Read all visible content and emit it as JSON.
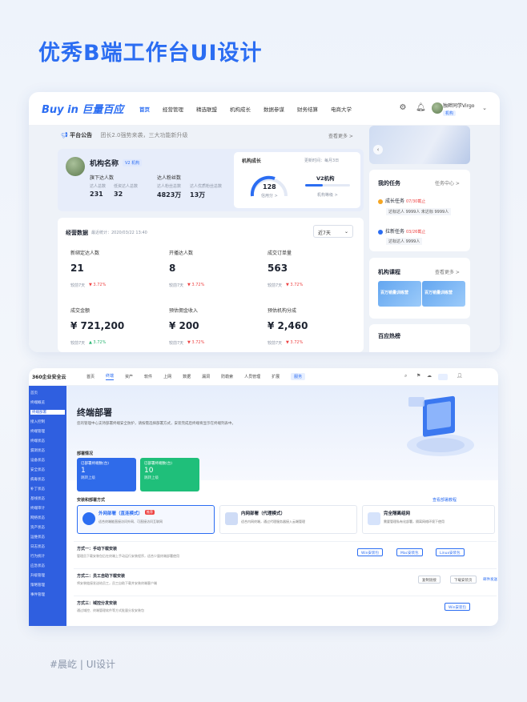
{
  "hero_title": "优秀B端工作台UI设计",
  "footer": "#晨屹 | UI设计",
  "card1": {
    "logo": "Buy in 巨量百应",
    "nav": [
      "首页",
      "经营管理",
      "精选联盟",
      "机构成长",
      "数据参谋",
      "财务结算",
      "电商大学"
    ],
    "user": {
      "name": "独畔同学Virgo",
      "tag": "机构"
    },
    "announce": {
      "title": "平台公告",
      "text": "团长2.0强势来袭，三大功能新升级",
      "more": "查看更多 >"
    },
    "org": {
      "name": "机构名称",
      "badge": "V2 机构",
      "talent_title": "旗下达人数",
      "talent_labels": [
        "达人总数",
        "低资达人总数"
      ],
      "talent_values": [
        "231",
        "32"
      ],
      "fans_title": "达人粉丝数",
      "fans_labels": [
        "达人粉丝总数",
        "达人优质粉丝总数"
      ],
      "fans_values": [
        "4823万",
        "13万"
      ],
      "growth_title": "机构成长",
      "update_time": "更新时间：每月3日",
      "score": "128",
      "score_label": "信用分 >",
      "level": "V2机构",
      "level_link": "机构等级 >"
    },
    "data": {
      "title": "经营数据",
      "updated": "最近统计：2020/03/22 13:40",
      "range": "近7天",
      "metrics": [
        {
          "label": "新绑定达人数",
          "value": "21",
          "cmp": "较前7天",
          "delta": "▼ 3.72%",
          "dir": "down"
        },
        {
          "label": "开播达人数",
          "value": "8",
          "cmp": "较前7天",
          "delta": "▼ 3.72%",
          "dir": "down"
        },
        {
          "label": "成交订单量",
          "value": "563",
          "cmp": "较前7天",
          "delta": "▼ 3.72%",
          "dir": "down"
        },
        {
          "label": "成交金额",
          "value": "¥ 721,200",
          "cmp": "较前7天",
          "delta": "▲ 3.72%",
          "dir": "up"
        },
        {
          "label": "预估佣金收入",
          "value": "¥ 200",
          "cmp": "较前7天",
          "delta": "▼ 3.72%",
          "dir": "down"
        },
        {
          "label": "预估机构分成",
          "value": "¥ 2,460",
          "cmp": "较前7天",
          "delta": "▼ 3.72%",
          "dir": "down"
        }
      ]
    },
    "tasks": {
      "title": "我的任务",
      "link": "任务中心 >",
      "items": [
        {
          "name": "成长任务",
          "date": "07/30截止",
          "line": "达标达人 9999人  未达标 9999人"
        },
        {
          "name": "拉新任务",
          "date": "03/26截止",
          "line": "达标达人 9999人"
        }
      ]
    },
    "course": {
      "title": "机构课程",
      "more": "查看更多 >",
      "items": [
        "百万销量训练营",
        "百万销量训练营"
      ]
    },
    "hot": {
      "title": "百应热榜"
    }
  },
  "card2": {
    "logo": "360企业安全云",
    "nav": [
      "首页",
      "终端",
      "资产",
      "软件",
      "上网",
      "数据",
      "漏洞",
      "防勒索",
      "人员管理",
      "扩展"
    ],
    "nav_extra": "服务",
    "side": [
      "首页",
      "终端概览",
      "终端部署",
      "接入控制",
      "终端管理",
      "终端状态",
      "漏洞状态",
      "设备状态",
      "安全状态",
      "病毒状态",
      "补丁状态",
      "基线状态",
      "终端审计",
      "网络状态",
      "资产状态",
      "运维状态",
      "日志状态",
      "行为统计",
      "应急状态",
      "升级管理",
      "策略管理",
      "事件管理"
    ],
    "hero": {
      "title": "终端部署",
      "desc": "您的管理中心支持部署终端安全防护，请按需选择部署方式，安装完成后终端将显示在终端列表中。"
    },
    "stats_title": "部署情况",
    "stats": [
      {
        "label": "已部署终端数(台)",
        "value": "1",
        "sub": "跳转上级"
      },
      {
        "label": "已部署终端数(台)",
        "value": "10",
        "sub": "跳转上级"
      }
    ],
    "section_title": "安装和部署方式",
    "section_link": "查看部署教程",
    "options": [
      {
        "title": "外网部署（直连模式）",
        "tag": "推荐",
        "desc": "适合终端能直接访问外网、可直接访问互联网"
      },
      {
        "title": "内网部署（代理模式）",
        "desc": "适合内网终端，通过代理服务器接入云端管理"
      },
      {
        "title": "完全隔离组网",
        "desc": "需要管理私有化部署，隔离网络环境下使用"
      }
    ],
    "methods": [
      {
        "title": "方式一：手动下载安装",
        "desc": "管理员下载安装包后在终端上手动运行安装程序，适合少量终端部署使用",
        "buttons": [
          "Win安装包",
          "Mac安装包",
          "Linux安装包"
        ]
      },
      {
        "title": "方式二：员工自助下载安装",
        "desc": "将安装链接发送给员工，员工自助下载并安装终端客户端",
        "buttons": [
          "复制链接",
          "下载安装页",
          "邮件发送"
        ]
      },
      {
        "title": "方式三：域控分发安装",
        "desc": "通过域控、终端管理软件等方式批量分发安装包",
        "buttons": [
          "Win安装包"
        ]
      }
    ]
  },
  "icons": [
    "bell-icon",
    "settings-icon",
    "chevron-down-icon",
    "search-icon",
    "flag-icon",
    "cloud-icon",
    "user-icon"
  ]
}
